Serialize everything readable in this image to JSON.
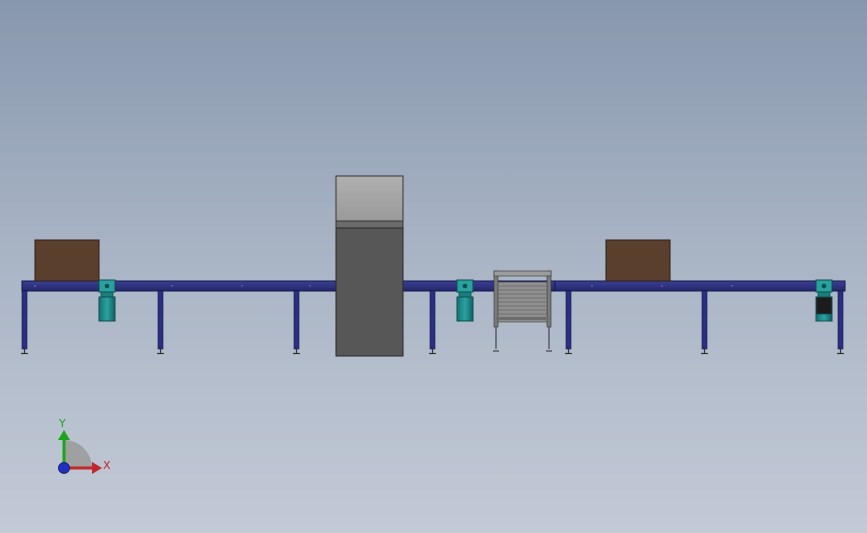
{
  "scene": {
    "background_top": "#8797ad",
    "background_bottom": "#c3cad6",
    "conveyor_color": "#2b2f7a",
    "conveyor_dark": "#1c1f55",
    "box_color": "#5a3f2c",
    "motor_color": "#1f8f8f",
    "machine_top_color": "#a8a8a8",
    "machine_body_color": "#575757",
    "frame_color": "#8a8a8a"
  },
  "triad": {
    "x_label": "X",
    "y_label": "Y",
    "x_color": "#c0282a",
    "y_color": "#1aa51a",
    "z_color": "#2030c0"
  }
}
